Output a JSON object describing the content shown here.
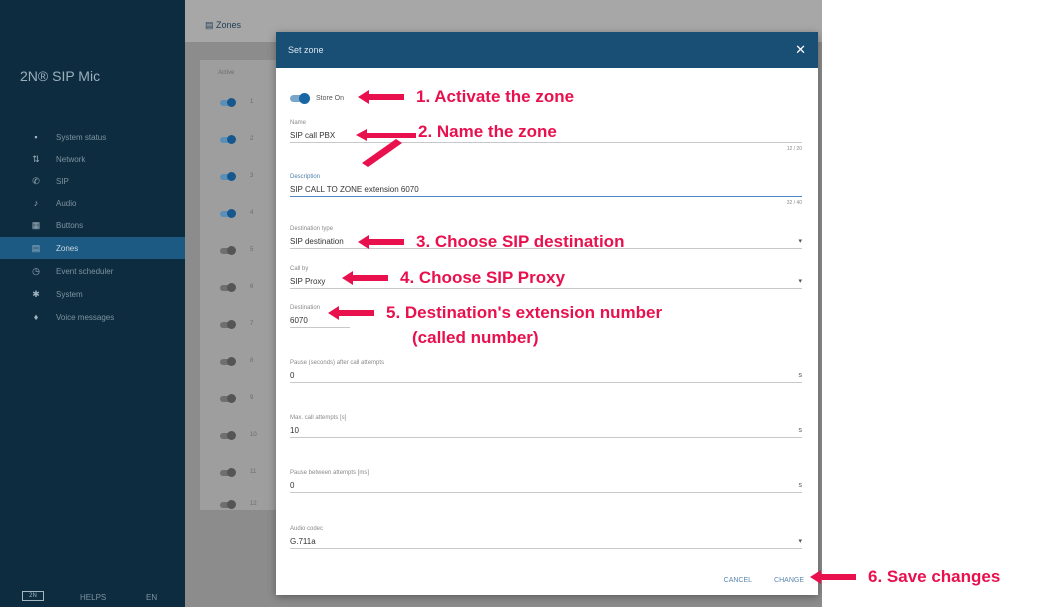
{
  "app": {
    "brand": "2N® SIP Mic",
    "sidebar": [
      {
        "label": "System status",
        "icon": "dashboard-icon"
      },
      {
        "label": "Network",
        "icon": "network-icon"
      },
      {
        "label": "SIP",
        "icon": "phone-icon"
      },
      {
        "label": "Audio",
        "icon": "music-note-icon"
      },
      {
        "label": "Buttons",
        "icon": "grid-icon"
      },
      {
        "label": "Zones",
        "icon": "zones-icon"
      },
      {
        "label": "Event scheduler",
        "icon": "clock-icon"
      },
      {
        "label": "System",
        "icon": "gear-icon"
      },
      {
        "label": "Voice messages",
        "icon": "microphone-icon"
      }
    ],
    "footer": {
      "logo": "2N",
      "left": "HELPS",
      "right": "EN"
    }
  },
  "page": {
    "title": "Zones",
    "column_header": "Active"
  },
  "zones": [
    {
      "number": "1",
      "active": true
    },
    {
      "number": "2",
      "active": true
    },
    {
      "number": "3",
      "active": true
    },
    {
      "number": "4",
      "active": true
    },
    {
      "number": "5",
      "active": false
    },
    {
      "number": "6",
      "active": false
    },
    {
      "number": "7",
      "active": false
    },
    {
      "number": "8",
      "active": false
    },
    {
      "number": "9",
      "active": false
    },
    {
      "number": "10",
      "active": false
    },
    {
      "number": "11",
      "active": false
    },
    {
      "number": "12",
      "active": false
    }
  ],
  "dialog": {
    "title": "Set zone",
    "store_label": "Store On",
    "fields": {
      "name": {
        "label": "Name",
        "value": "SIP call PBX",
        "counter": "12 / 20"
      },
      "description": {
        "label": "Description",
        "value": "SIP CALL TO ZONE extension 6070",
        "counter": "32 / 40"
      },
      "destination_type": {
        "label": "Destination type",
        "value": "SIP destination"
      },
      "call_by": {
        "label": "Call by",
        "value": "SIP Proxy"
      },
      "destination": {
        "label": "Destination",
        "value": "6070"
      },
      "pause": {
        "label": "Pause (seconds) after call attempts",
        "value": "0",
        "suffix": "s"
      },
      "max_call_attempts": {
        "label": "Max. call attempts [s]",
        "value": "10",
        "suffix": "s"
      },
      "pause_between": {
        "label": "Pause between attempts [ms]",
        "value": "0",
        "suffix": "s"
      },
      "audio_codec": {
        "label": "Audio codec",
        "value": "G.711a"
      }
    },
    "buttons": {
      "cancel": "CANCEL",
      "save": "CHANGE"
    }
  },
  "annotations": [
    {
      "text": "1. Activate the zone"
    },
    {
      "text": "2. Name the zone"
    },
    {
      "text": "3. Choose SIP destination"
    },
    {
      "text": "4. Choose SIP Proxy"
    },
    {
      "text": "5. Destination's extension number",
      "sub": "(called number)"
    },
    {
      "text": "6. Save changes"
    }
  ],
  "colors": {
    "sidebar": "#0e2c3f",
    "sidebar_active": "#1d5a83",
    "dialog_header": "#1a4f75",
    "annotation": "#e8104d",
    "accent": "#1866a3"
  }
}
